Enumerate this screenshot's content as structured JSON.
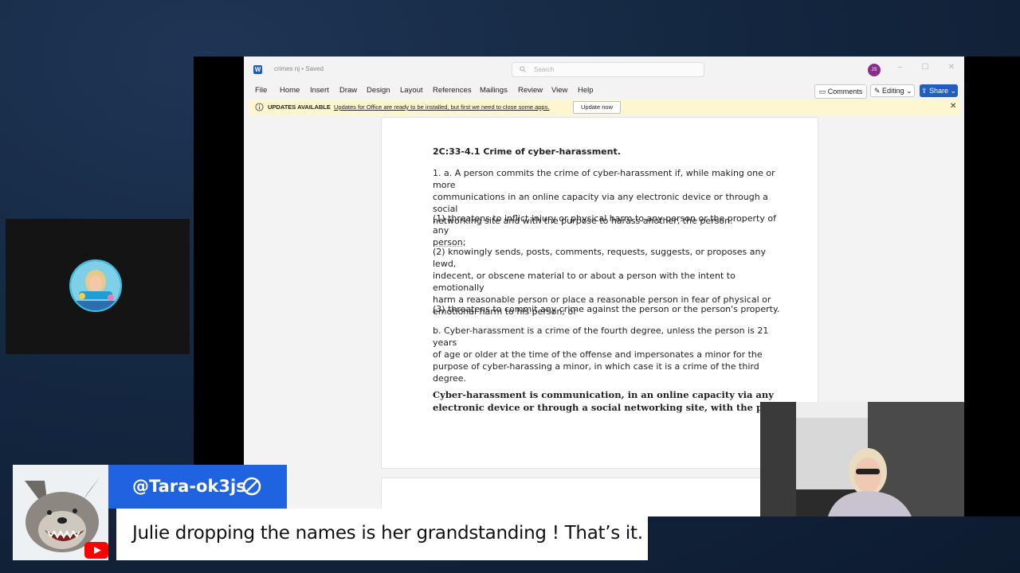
{
  "word": {
    "doc_name": "crimes nj • Saved",
    "search_placeholder": "Search",
    "avatar_initials": "JS",
    "menu": [
      "File",
      "Home",
      "Insert",
      "Draw",
      "Design",
      "Layout",
      "References",
      "Mailings",
      "Review",
      "View",
      "Help"
    ],
    "comments_label": "Comments",
    "editing_label": "Editing",
    "share_label": "Share",
    "update_title": "UPDATES AVAILABLE",
    "update_text": "Updates for Office are ready to be installed, but first we need to close some apps.",
    "update_button": "Update now"
  },
  "document": {
    "heading": "2C:33-4.1 Crime of cyber-harassment.",
    "para1": [
      "1. a. A person commits the crime of cyber-harassment if, while making one or more",
      "communications in an online capacity via any electronic device or through a social",
      "networking site and with the purpose to harass another, the person:"
    ],
    "para2": [
      "(1) threatens to inflict injury or physical harm to any person or the property of any",
      "person;"
    ],
    "para3": [
      "(2) knowingly sends, posts, comments, requests, suggests, or proposes any lewd,",
      "indecent, or obscene material to or about a person with the intent to emotionally",
      "harm a reasonable person or place a reasonable person in fear of physical or",
      "emotional harm to his person; or"
    ],
    "para4": [
      "(3) threatens to commit any crime against the person or the person's property."
    ],
    "para5": [
      "b. Cyber-harassment is a crime of the fourth degree, unless the person is 21 years",
      "of age or older at the time of the offense and impersonates a minor for the",
      "purpose of cyber-harassing a minor, in which case it is a crime of the third degree."
    ],
    "para6": [
      "Cyber-harassment is communication, in an online capacity via any",
      "electronic device or through a social networking site, with the purpose"
    ]
  },
  "chat": {
    "username": "@Tara-ok3js",
    "message": "Julie dropping the names is her grandstanding ! That’s it."
  },
  "colors": {
    "word_accent": "#1f5fbf",
    "chat_accent": "#1f63e0",
    "update_bar": "#fdf6cf"
  }
}
